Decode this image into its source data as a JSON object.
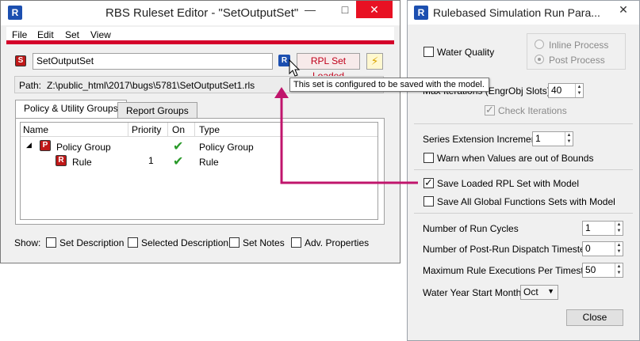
{
  "editor": {
    "title": "RBS Ruleset Editor - \"SetOutputSet\"",
    "menu": [
      "File",
      "Edit",
      "Set",
      "View"
    ],
    "set_name": "SetOutputSet",
    "rpl_button": "RPL Set Loaded",
    "path_label": "Path:",
    "path_value": "Z:\\public_html\\2017\\bugs\\5781\\SetOutputSet1.rls",
    "tooltip": "This set is configured to be saved with the model.",
    "tabs": [
      "Policy & Utility Groups",
      "Report Groups"
    ],
    "columns": [
      "Name",
      "Priority",
      "On",
      "Type"
    ],
    "rows": [
      {
        "name": "Policy Group",
        "priority": "",
        "type": "Policy Group",
        "badge": "P"
      },
      {
        "name": "Rule",
        "priority": "1",
        "type": "Rule",
        "badge": "R"
      }
    ],
    "show_label": "Show:",
    "show_options": [
      "Set Description",
      "Selected Description",
      "Set Notes",
      "Adv. Properties"
    ]
  },
  "run": {
    "title": "Rulebased Simulation Run Para...",
    "water_quality": "Water Quality",
    "inline_process": "Inline Process",
    "post_process": "Post Process",
    "max_iterations_label": "Max Iterations  (EngrObj Slots)",
    "max_iterations_value": "40",
    "check_iterations": "Check Iterations",
    "series_ext_label": "Series Extension Increment",
    "series_ext_value": "1",
    "warn_label": "Warn when Values are out of Bounds",
    "save_rpl_label": "Save Loaded RPL Set with Model",
    "save_global_label": "Save All Global Functions Sets with Model",
    "run_cycles_label": "Number of Run Cycles",
    "run_cycles_value": "1",
    "post_run_label": "Number of Post-Run Dispatch Timesteps",
    "post_run_value": "0",
    "max_rule_label": "Maximum Rule Executions Per Timestep",
    "max_rule_value": "50",
    "water_year_label": "Water Year Start Month:",
    "water_year_value": "Oct",
    "close": "Close"
  },
  "colors": {
    "accent_red": "#d4002a",
    "arrow": "#c0156c",
    "check_green": "#2a9a2a"
  }
}
